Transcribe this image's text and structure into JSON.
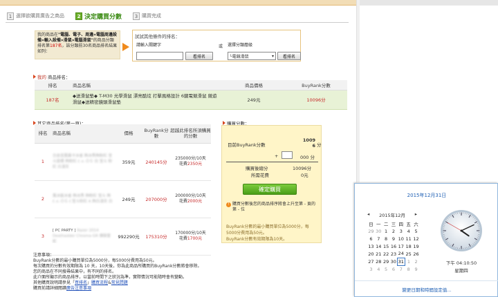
{
  "steps": [
    {
      "num": "1",
      "label": "選擇欲購買廣告之商品"
    },
    {
      "num": "2",
      "label": "決定購買分數"
    },
    {
      "num": "3",
      "label": "購買完成"
    }
  ],
  "intro": {
    "line1a": "我的商品在",
    "line1b": "\"電腦、電子、周邊»電腦周邊設備»輸入設備»滑鼠»電腦滑鼠\"",
    "line2a": "的商品分類排名第",
    "rank": "187名",
    "line2b": "，該分類前30名商品排名結果如列："
  },
  "search": {
    "title": "試試其他條件的排名：",
    "keyword_label": "請輸入關鍵字",
    "keyword_value": "",
    "or_label": "或",
    "category_label": "選擇分類層級",
    "category_value": "└電競滑鼠",
    "button1": "看排名",
    "button2": "看排名"
  },
  "myrank": {
    "title_a": "我的",
    "title_b": "商品排名：",
    "headers": [
      "排名",
      "商品名稱",
      "商品價格",
      "BuyRank分數"
    ],
    "rank": "187名",
    "name": "◆送滑鼠墊◆ T-M30 光學滑鼠 漂亮酷炫 打擊風格設計 6鍵電競滑鼠 競遊 滑鼠◆送精密鏡頭滑鼠墊",
    "price": "249元",
    "score": "10096分"
  },
  "others": {
    "title": "其它商品排名(第一頁)：",
    "headers": [
      "排名",
      "商品名稱",
      "價格",
      "BuyRank分數",
      "超越此排名所須購買的分數"
    ],
    "rows": [
      {
        "rank": "1",
        "name": "旦皮吝匯羼卡冰雀 夠冰秀夠粉紅 宝斗鼠標 夠粉紅 ℓ.ｏ.ＯＧ 白 宝斗 粉紅 白淺灰",
        "price": "359元",
        "score": "240145分",
        "target_a": "235000分/10天",
        "target_b": "花費",
        "target_cost": "2350元"
      },
      {
        "rank": "2",
        "name": "萬冰能冰雀 夠冰秀 夠粉紅 宝斗 夠 ℓ.ｏ.ＯＧ ℓ.宝斗粉紅 A 夠白淺灰 白",
        "price": "249元",
        "score": "207000分",
        "target_a": "200000分/10天",
        "target_b": "花費",
        "target_cost": "2000元"
      },
      {
        "rank": "3",
        "name_clear": "[ PC PARTY ]",
        "name": "Razer 2014 Deathadder Chroma GR 煉獄奎蛇",
        "price": "992290元",
        "score": "175310分",
        "target_a": "170000分/10天",
        "target_b": "花費",
        "target_cost": "1700元"
      }
    ]
  },
  "purchase": {
    "title": "購買分數：",
    "current_label": "目前BuyRank分數",
    "current_value_1": "1009",
    "current_value_2": "6",
    "unit": "分",
    "plus": "+",
    "add_value": "",
    "add_suffix": "000 分",
    "after_label": "購買後總分",
    "after_value": "10096分",
    "cost_label": "所需花費",
    "cost_value": "0元",
    "buy_button": "確定購買",
    "note": "購買分數後您的商品排序將會上升至第 - 頁的第 - 位",
    "hint_1": "BuyRank分數的最小購買單位為5000分，每5000分費用為50元。",
    "hint_2": "BuyRank分數有效期限為10天。"
  },
  "notes": {
    "title": "注意事項：",
    "lines": [
      "BuyRank分數的最小購買單位為5000分，每5000分費用為50元。",
      "每次購買的分數有效期限為 10 天，10天後，你為此商品所購買的BuyRank分數將會移除。",
      "您的商品在不同搜尋結果中，有不同的排名。",
      "此介面所顯示的商品排序，以當前時間下之狀況為準，實際情況可能隨時會有變動。",
      "其他購買說明請參見「",
      "購買前請詳細閱讀"
    ],
    "link1": "買排名",
    "link1b": "」",
    "link2": "購買流程",
    "link3": "常見問題",
    "link4": "廣告注意事項"
  },
  "calendar": {
    "date_title": "2015年12月31日",
    "month_label": "2015年12月",
    "weekdays": [
      "日",
      "一",
      "二",
      "三",
      "四",
      "五",
      "六"
    ],
    "weeks": [
      [
        "29",
        "30",
        "1",
        "2",
        "3",
        "4",
        "5"
      ],
      [
        "6",
        "7",
        "8",
        "9",
        "10",
        "11",
        "12"
      ],
      [
        "13",
        "14",
        "15",
        "16",
        "17",
        "18",
        "19"
      ],
      [
        "20",
        "21",
        "22",
        "23",
        "24",
        "25",
        "26"
      ],
      [
        "27",
        "28",
        "29",
        "30",
        "31",
        "1",
        "2"
      ],
      [
        "3",
        "4",
        "5",
        "6",
        "7",
        "8",
        "9"
      ]
    ],
    "time": "下午 04:10:50",
    "weekday_today": "星期四",
    "settings_link": "變更日期和時間設定值..."
  }
}
